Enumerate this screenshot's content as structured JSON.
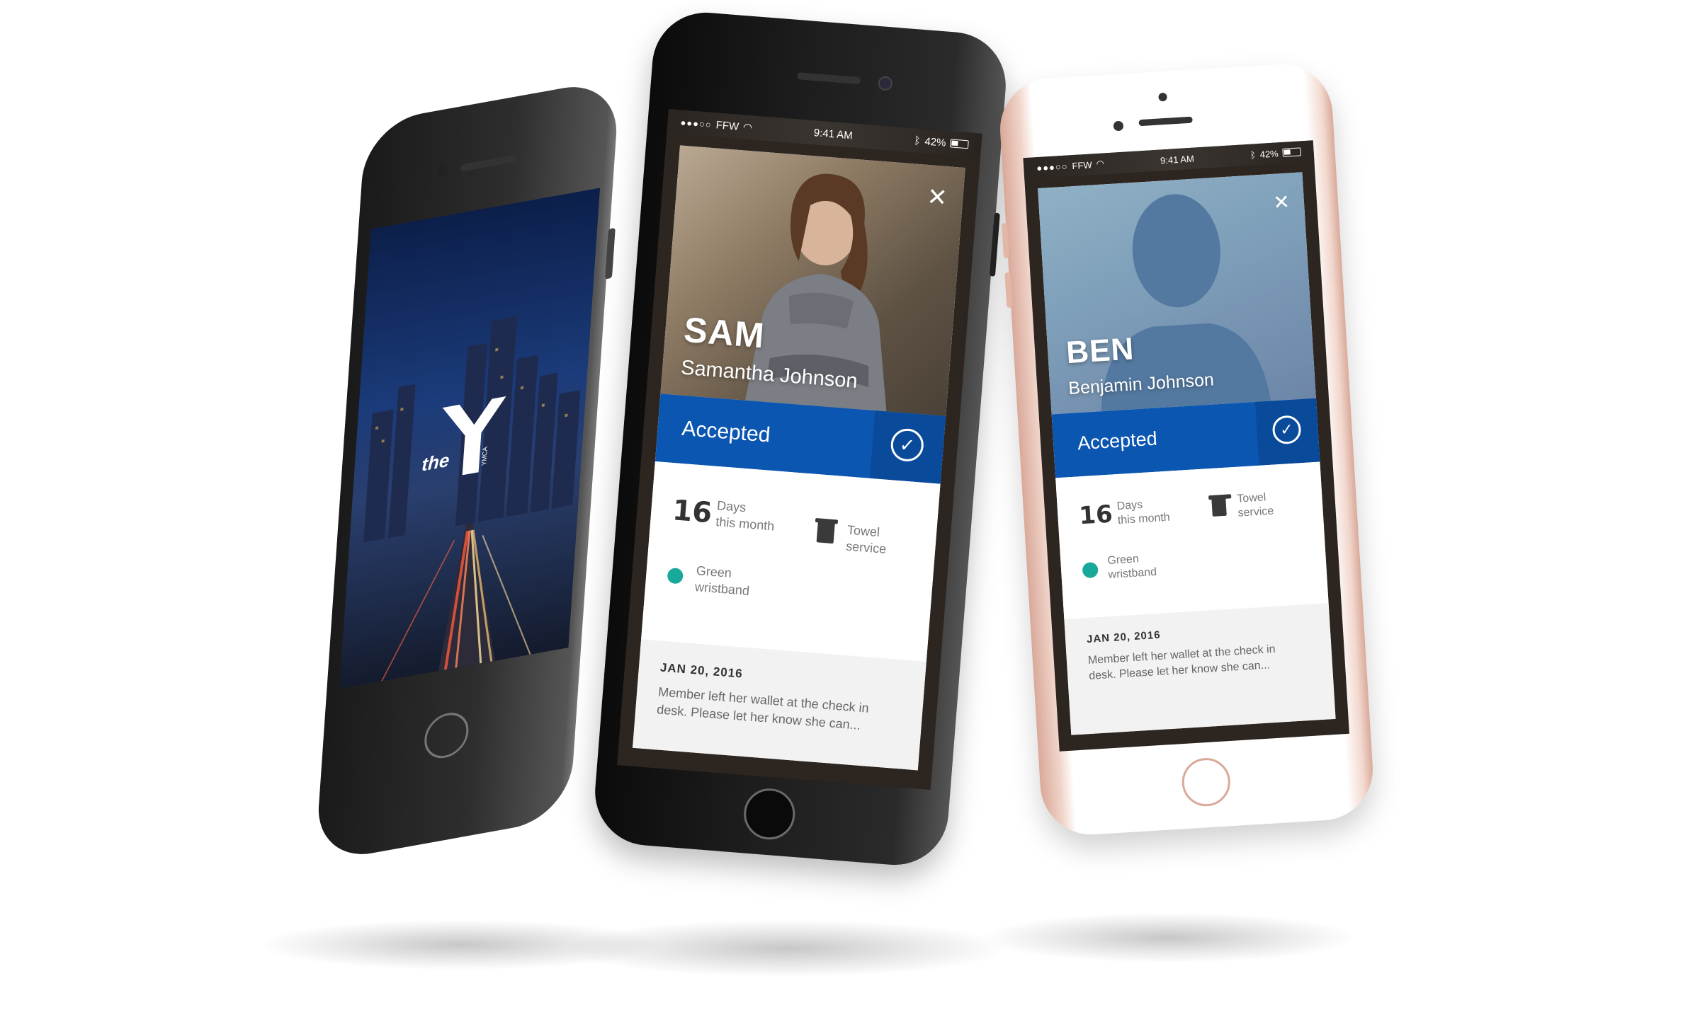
{
  "splash": {
    "logo_text": "the",
    "logo_mark": "YMCA"
  },
  "status_bar": {
    "carrier": "FFW",
    "time": "9:41 AM",
    "battery": "42%"
  },
  "members": [
    {
      "nickname": "SAM",
      "full_name": "Samantha Johnson",
      "status_label": "Accepted",
      "days_count": "16",
      "days_label_1": "Days",
      "days_label_2": "this month",
      "towel_label_1": "Towel",
      "towel_label_2": "service",
      "wristband_label_1": "Green",
      "wristband_label_2": "wristband",
      "note_date": "JAN 20, 2016",
      "note_text": "Member left her wallet at the check in desk. Please let her know she can..."
    },
    {
      "nickname": "BEN",
      "full_name": "Benjamin Johnson",
      "status_label": "Accepted",
      "days_count": "16",
      "days_label_1": "Days",
      "days_label_2": "this month",
      "towel_label_1": "Towel",
      "towel_label_2": "service",
      "wristband_label_1": "Green",
      "wristband_label_2": "wristband",
      "note_date": "JAN 20, 2016",
      "note_text": "Member left her wallet at the check in desk. Please let her know she can..."
    }
  ],
  "icons": {
    "close": "close-icon",
    "check": "check-circle-icon",
    "towel": "towel-icon",
    "wristband": "wristband-icon",
    "wifi": "wifi-icon",
    "bluetooth": "bluetooth-icon",
    "battery": "battery-icon"
  },
  "colors": {
    "accent_blue": "#0b56b0",
    "wristband_green": "#18a99a",
    "rose_gold": "#e9c9bd",
    "jet_black": "#111111"
  }
}
